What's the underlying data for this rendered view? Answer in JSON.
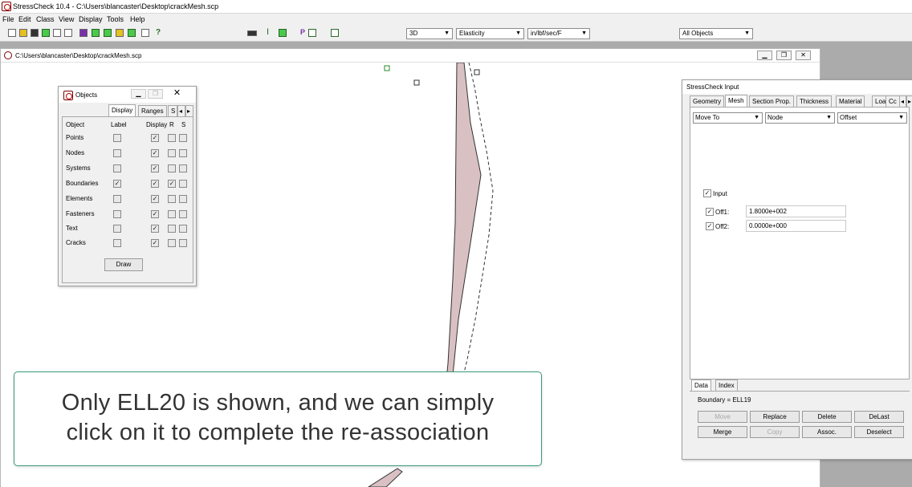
{
  "app": {
    "title": "StressCheck 10.4 - C:\\Users\\blancaster\\Desktop\\crackMesh.scp"
  },
  "menu": [
    "File",
    "Edit",
    "Class",
    "View",
    "Display",
    "Tools",
    "Help"
  ],
  "toolbar": {
    "view_mode": "3D",
    "analysis_type": "Elasticity",
    "units": "in/lbf/sec/F",
    "object_filter": "All Objects",
    "p_label": "P"
  },
  "document": {
    "title": "C:\\Users\\blancaster\\Desktop\\crackMesh.scp"
  },
  "objects_panel": {
    "title": "Objects",
    "tabs": [
      "Display",
      "Ranges",
      "S"
    ],
    "header": {
      "display": "Display",
      "object": "Object",
      "label": "Label",
      "display_col": "Display",
      "r": "R",
      "s": "S"
    },
    "rows": [
      {
        "name": "Points",
        "label": false,
        "display": true,
        "r": false,
        "s": false
      },
      {
        "name": "Nodes",
        "label": false,
        "display": true,
        "r": false,
        "s": false
      },
      {
        "name": "Systems",
        "label": false,
        "display": true,
        "r": false,
        "s": false
      },
      {
        "name": "Boundaries",
        "label": true,
        "display": true,
        "r": true,
        "s": false
      },
      {
        "name": "Elements",
        "label": false,
        "display": true,
        "r": false,
        "s": false
      },
      {
        "name": "Fasteners",
        "label": false,
        "display": true,
        "r": false,
        "s": false
      },
      {
        "name": "Text",
        "label": false,
        "display": true,
        "r": false,
        "s": false
      },
      {
        "name": "Cracks",
        "label": false,
        "display": true,
        "r": false,
        "s": false
      }
    ],
    "draw_button": "Draw"
  },
  "input_panel": {
    "title": "StressCheck Input",
    "tabs": [
      "Geometry",
      "Mesh",
      "Section Prop.",
      "Thickness",
      "Material",
      "Load",
      "Cc"
    ],
    "active_tab": "Mesh",
    "dropdowns": {
      "action": "Move To",
      "object": "Node",
      "method": "Offset"
    },
    "input_checkbox": "Input",
    "fields": [
      {
        "label": "Off1:",
        "value": "1.8000e+002"
      },
      {
        "label": "Off2:",
        "value": "0.0000e+000"
      }
    ],
    "bottom_tabs": [
      "Data",
      "Index"
    ],
    "status": "Boundary = ELL19",
    "buttons_row1": [
      "Move",
      "Replace",
      "Delete",
      "DeLast"
    ],
    "buttons_row2": [
      "Merge",
      "Copy",
      "Assoc.",
      "Deselect"
    ]
  },
  "caption": {
    "line1": "Only ELL20 is shown, and we can simply",
    "line2": "click on it to complete the re-association"
  }
}
